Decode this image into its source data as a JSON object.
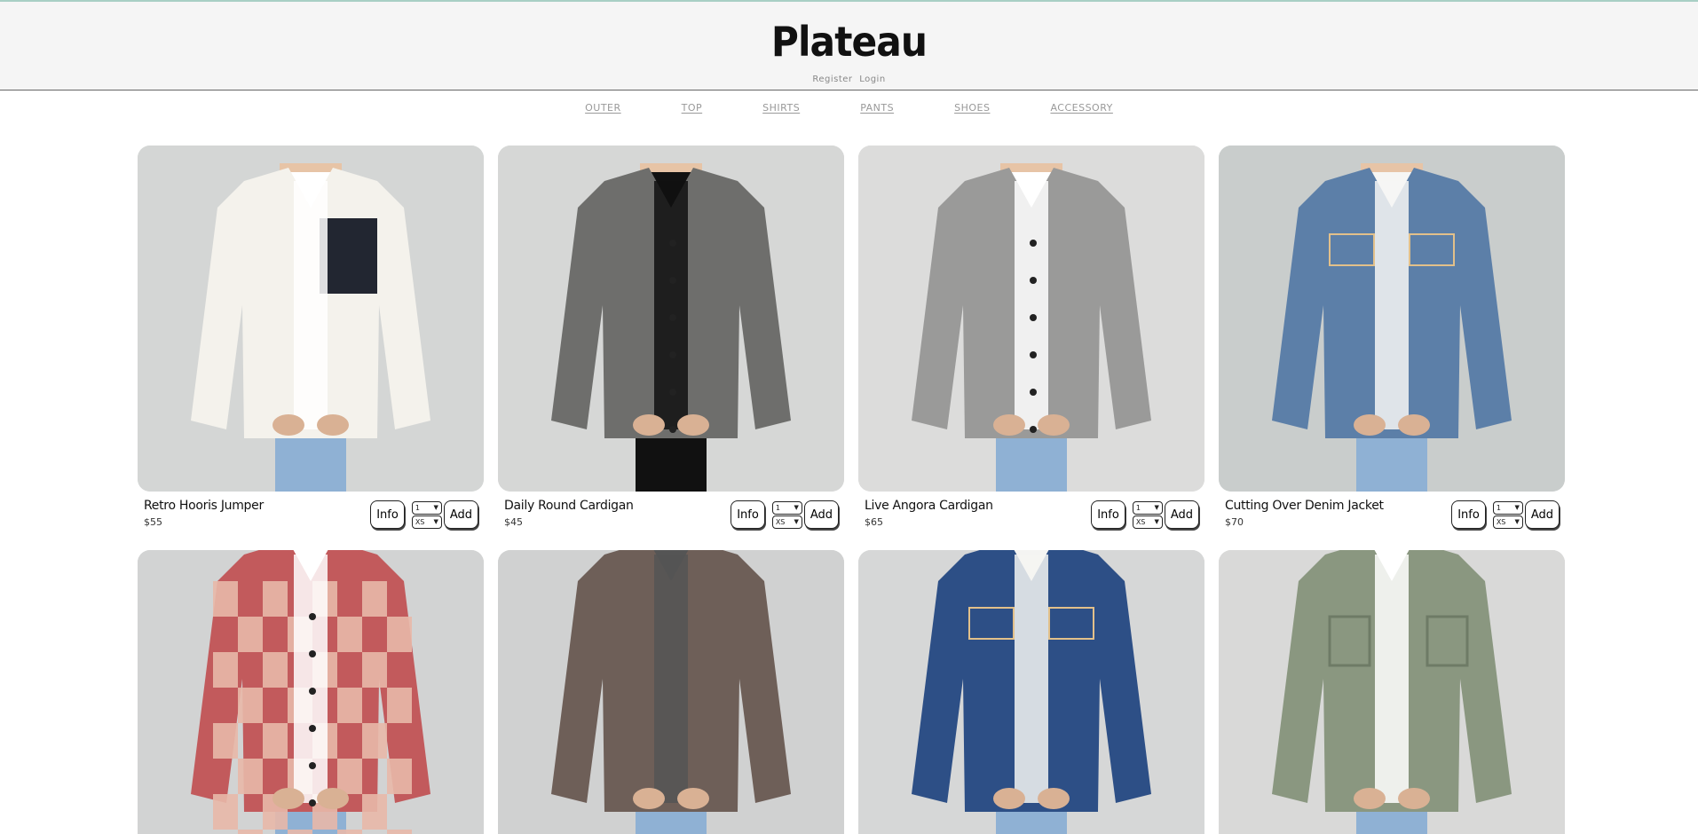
{
  "brand": {
    "logo": "Plateau",
    "register": "Register",
    "login": "Login"
  },
  "nav": [
    "OUTER",
    "TOP",
    "SHIRTS",
    "PANTS",
    "SHOES",
    "ACCESSORY"
  ],
  "product_controls": {
    "info_label": "Info",
    "add_label": "Add",
    "qty": "1",
    "size": "XS"
  },
  "products": [
    {
      "name": "Retro Hooris Jumper",
      "price": "$55",
      "icon": "fleece-jacket-photo",
      "colors": {
        "garment": "#f4f2ec",
        "accent": "#222631",
        "inner": "#ffffff",
        "bg": "#d4d6d5"
      }
    },
    {
      "name": "Daily Round Cardigan",
      "price": "$45",
      "icon": "cardigan-photo",
      "colors": {
        "garment": "#6e6e6c",
        "accent": "#111111",
        "inner": "#111111",
        "bg": "#d6d7d6"
      }
    },
    {
      "name": "Live Angora Cardigan",
      "price": "$65",
      "icon": "cardigan-photo",
      "colors": {
        "garment": "#9a9a99",
        "accent": "#8bb0d6",
        "inner": "#ffffff",
        "bg": "#dcdcdb"
      }
    },
    {
      "name": "Cutting Over Denim Jacket",
      "price": "$70",
      "icon": "denim-jacket-photo",
      "colors": {
        "garment": "#5c7fa8",
        "accent": "#e7e2cf",
        "inner": "#f6f6f4",
        "bg": "#c9cdcc"
      }
    },
    {
      "name": "",
      "price": "",
      "icon": "checkered-cardigan-photo",
      "colors": {
        "garment": "#c25a5c",
        "accent": "#e8b8a8",
        "inner": "#ffffff",
        "bg": "#d2d3d3"
      }
    },
    {
      "name": "",
      "price": "",
      "icon": "blazer-photo",
      "colors": {
        "garment": "#6e5f58",
        "accent": "#555555",
        "inner": "#555555",
        "bg": "#d0d1d1"
      }
    },
    {
      "name": "",
      "price": "",
      "icon": "denim-jacket-photo",
      "colors": {
        "garment": "#2d4f86",
        "accent": "#f0f0ee",
        "inner": "#f4f4f2",
        "bg": "#d6d7d7"
      }
    },
    {
      "name": "",
      "price": "",
      "icon": "field-jacket-photo",
      "colors": {
        "garment": "#8a9780",
        "accent": "#2f3d5d",
        "inner": "#ffffff",
        "bg": "#d9d9d8"
      }
    }
  ]
}
